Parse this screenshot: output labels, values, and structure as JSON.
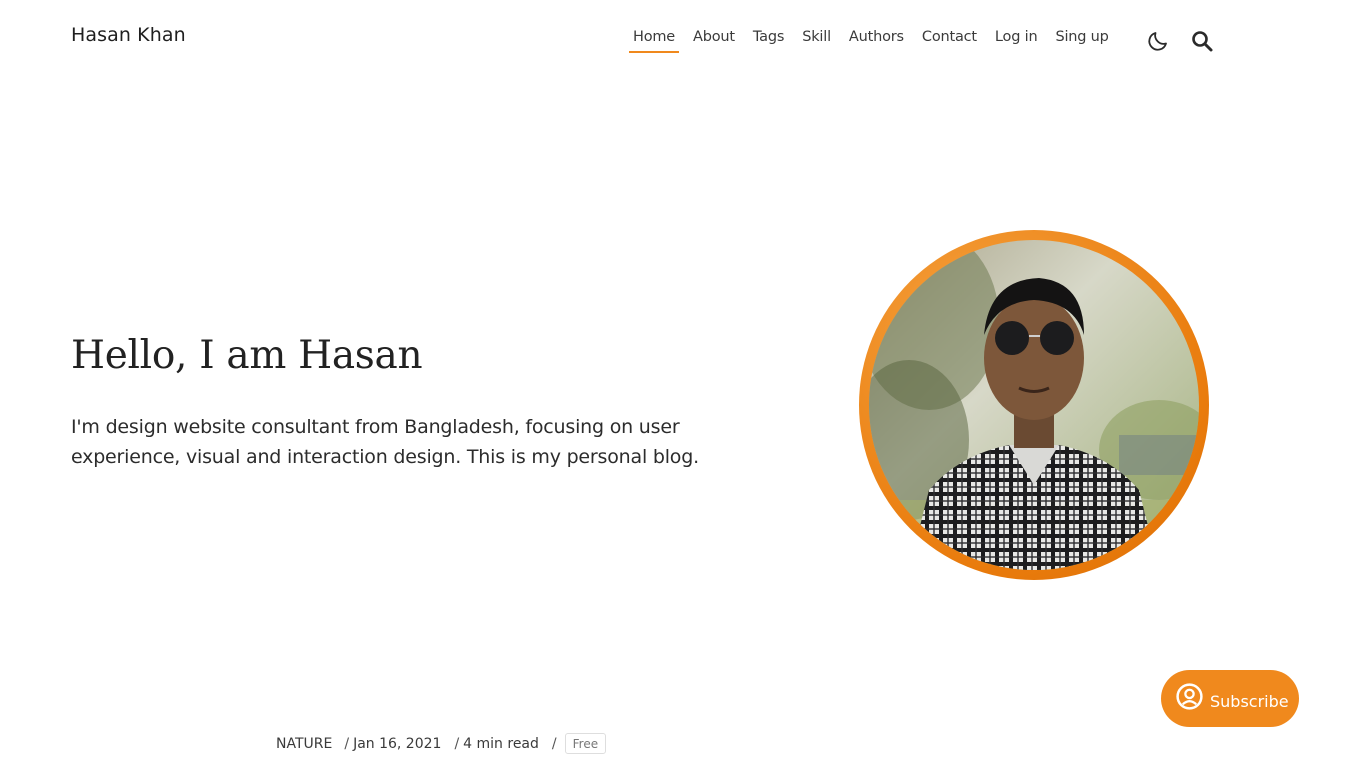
{
  "site": {
    "title": "Hasan Khan"
  },
  "nav": {
    "items": [
      {
        "label": "Home",
        "active": true
      },
      {
        "label": "About"
      },
      {
        "label": "Tags"
      },
      {
        "label": "Skill"
      },
      {
        "label": "Authors"
      },
      {
        "label": "Contact"
      },
      {
        "label": "Log in"
      },
      {
        "label": "Sing up"
      }
    ],
    "icons": [
      "moon-icon",
      "search-icon"
    ]
  },
  "hero": {
    "title": "Hello, I am Hasan",
    "description": "I'm design website consultant from Bangladesh, focusing on user experience, visual and interaction design. This is my personal blog."
  },
  "post_meta": {
    "tag": "NATURE",
    "date": "Jan 16, 2021",
    "read_time": "4 min read",
    "access": "Free",
    "separator": "/"
  },
  "subscribe": {
    "label": "Subscribe",
    "icon": "user-circle-icon"
  },
  "colors": {
    "accent": "#f0891d",
    "text": "#222222",
    "background": "#ffffff"
  }
}
